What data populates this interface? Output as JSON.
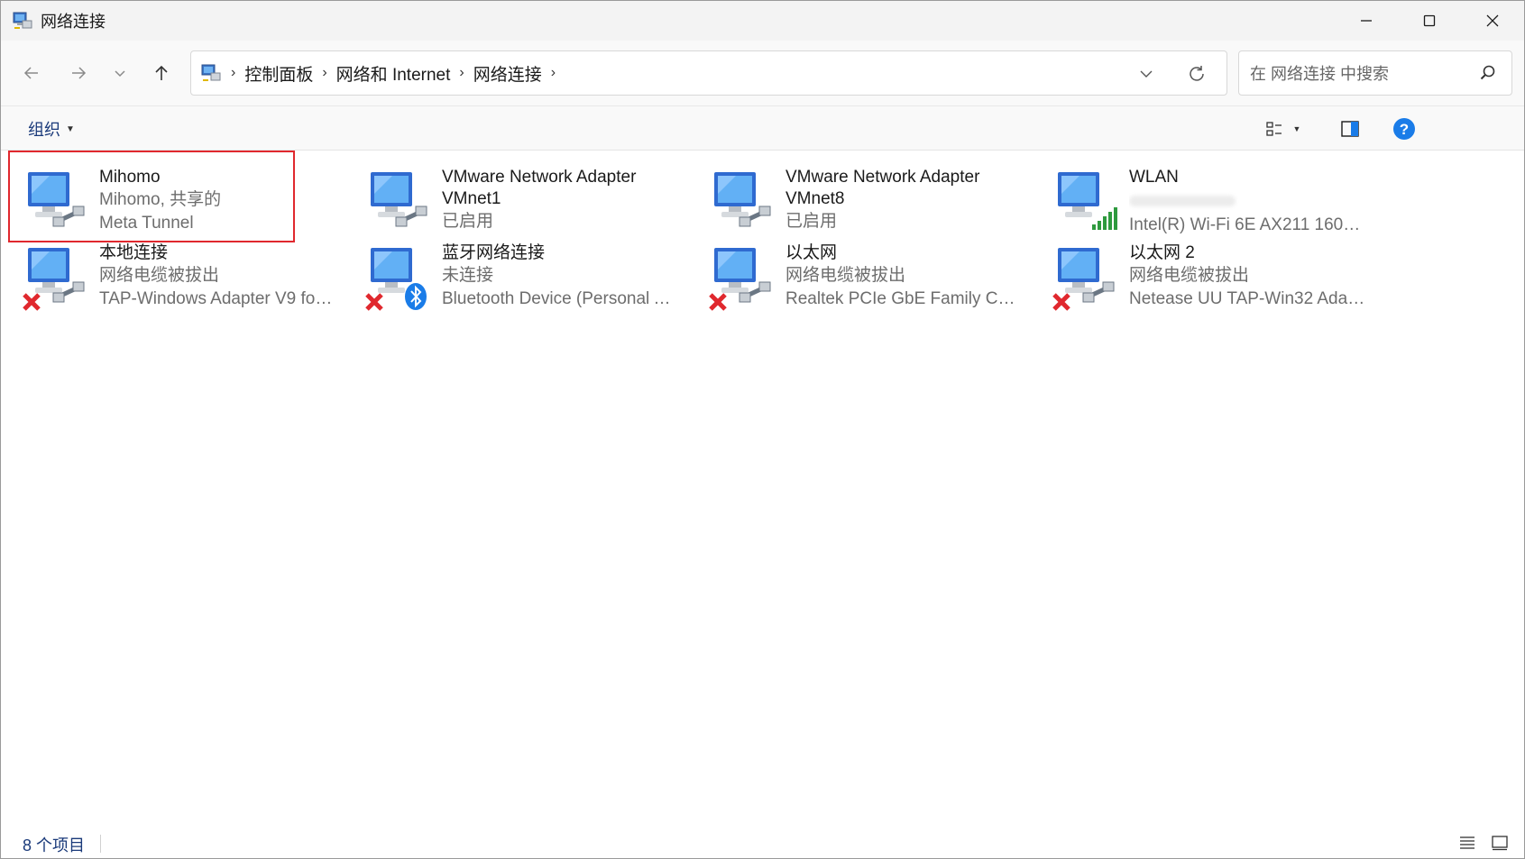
{
  "window": {
    "title": "网络连接",
    "controls": {
      "minimize": "minimize-icon",
      "maximize": "maximize-icon",
      "close": "close-icon"
    }
  },
  "address": {
    "crumbs": [
      "控制面板",
      "网络和 Internet",
      "网络连接"
    ],
    "search_placeholder": "在 网络连接 中搜索"
  },
  "toolbar": {
    "organize_label": "组织"
  },
  "connections": [
    {
      "name": "Mihomo",
      "status": "Mihomo, 共享的",
      "device": "Meta Tunnel",
      "overlay": "none",
      "selected": true
    },
    {
      "name": "VMware Network Adapter",
      "name2": "VMnet1",
      "status": "已启用",
      "overlay": "none",
      "selected": false
    },
    {
      "name": "VMware Network Adapter",
      "name2": "VMnet8",
      "status": "已启用",
      "overlay": "none",
      "selected": false
    },
    {
      "name": "WLAN",
      "device": "Intel(R) Wi-Fi 6E AX211 160M...",
      "overlay": "wifi-bars",
      "selected": false
    },
    {
      "name": "本地连接",
      "status": "网络电缆被拔出",
      "device": "TAP-Windows Adapter V9 for ...",
      "overlay": "red-x",
      "selected": false
    },
    {
      "name": "蓝牙网络连接",
      "status": "未连接",
      "device": "Bluetooth Device (Personal Are...",
      "overlay": "red-x-bluetooth",
      "selected": false
    },
    {
      "name": "以太网",
      "status": "网络电缆被拔出",
      "device": "Realtek PCIe GbE Family Contr...",
      "overlay": "red-x",
      "selected": false
    },
    {
      "name": "以太网 2",
      "status": "网络电缆被拔出",
      "device": "Netease UU TAP-Win32 Adapt...",
      "overlay": "red-x",
      "selected": false
    }
  ],
  "status": {
    "item_count": "8 个项目"
  },
  "colors": {
    "accent": "#0067c0",
    "selection_border": "#e0282e",
    "wifi_green": "#2e9a3e",
    "error_red": "#e0282e",
    "help_blue": "#1a7ce8"
  }
}
